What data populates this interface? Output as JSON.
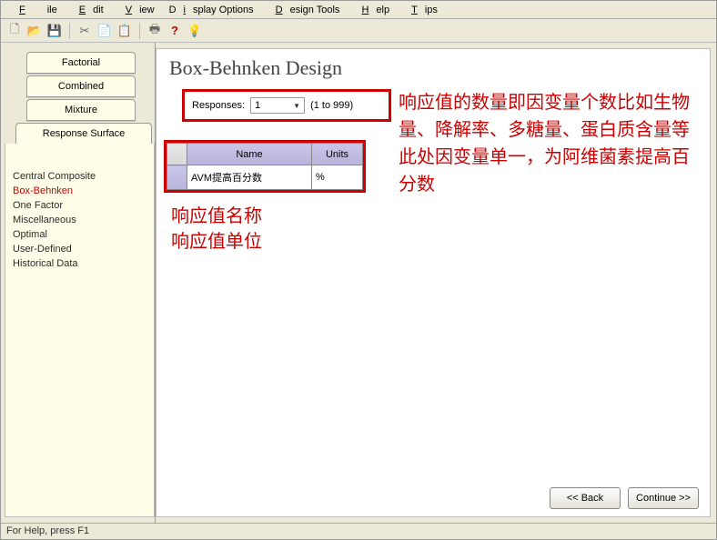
{
  "menu": {
    "file": "File",
    "edit": "Edit",
    "view": "View",
    "display_options": "Display Options",
    "design_tools": "Design Tools",
    "help": "Help",
    "tips": "Tips"
  },
  "toolbar_icons": {
    "new": "new-icon",
    "open": "open-icon",
    "save": "save-icon",
    "cut": "cut-icon",
    "copy": "copy-icon",
    "paste": "paste-icon",
    "print": "print-icon",
    "help": "help-icon",
    "tip": "lightbulb-icon"
  },
  "sidebar": {
    "tabs": {
      "factorial": "Factorial",
      "combined": "Combined",
      "mixture": "Mixture",
      "response_surface": "Response Surface"
    },
    "items": [
      "Central Composite",
      "Box-Behnken",
      "One Factor",
      "Miscellaneous",
      "Optimal",
      "User-Defined",
      "Historical Data"
    ],
    "selected_index": 1
  },
  "content": {
    "title": "Box-Behnken Design",
    "responses": {
      "label": "Responses:",
      "value": "1",
      "range": "(1 to 999)"
    },
    "table": {
      "headers": {
        "name": "Name",
        "units": "Units"
      },
      "row": {
        "name": "AVM提高百分数",
        "units": "%"
      }
    },
    "annotation_right": "响应值的数量即因变量个数比如生物量、降解率、多糖量、蛋白质含量等\n此处因变量单一，为阿维菌素提高百分数",
    "annotation_left_1": "响应值名称",
    "annotation_left_2": "响应值单位",
    "buttons": {
      "back": "<< Back",
      "continue": "Continue >>"
    }
  },
  "statusbar": "For Help, press F1"
}
